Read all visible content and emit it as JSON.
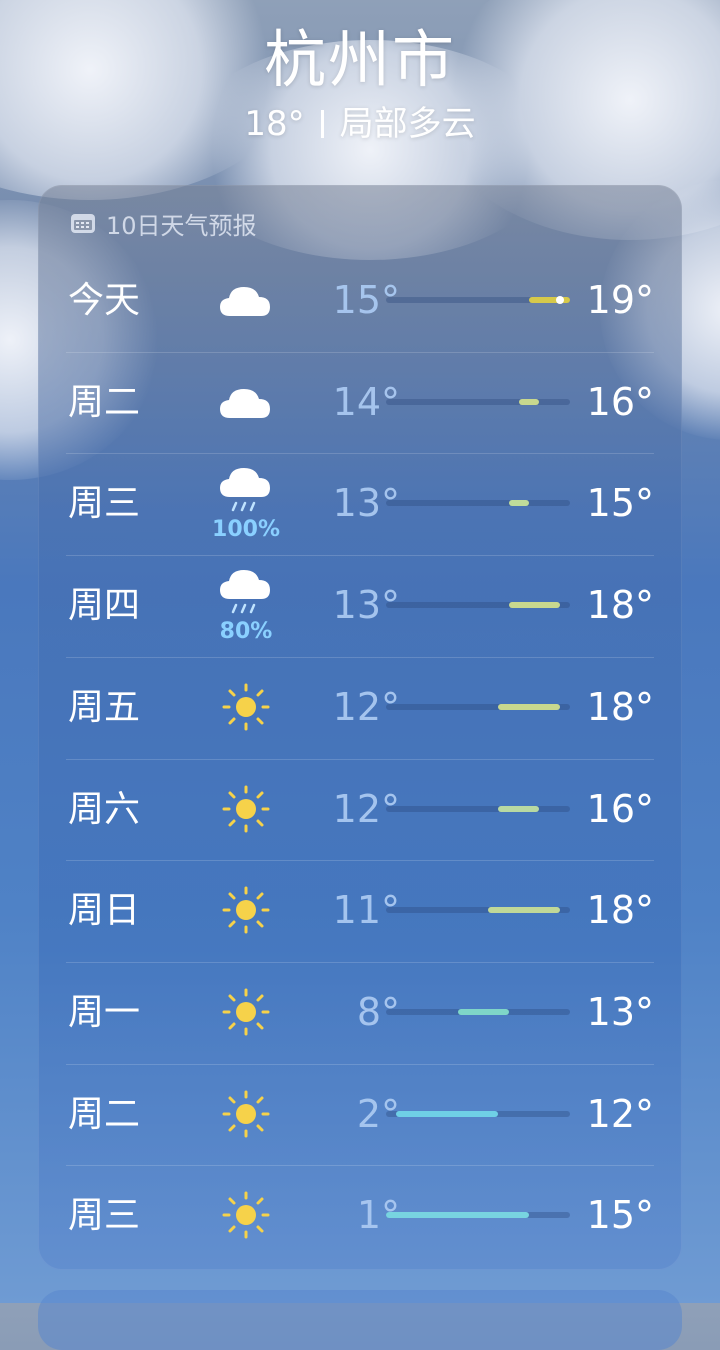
{
  "header": {
    "city": "杭州市",
    "current_temp": "18°",
    "condition": "局部多云"
  },
  "forecast": {
    "title": "10日天气预报",
    "icon": "calendar-icon",
    "range": {
      "min": 1,
      "max": 19
    },
    "current_temp_value": 18,
    "days": [
      {
        "day": "今天",
        "icon": "cloud",
        "low": "15°",
        "high": "19°",
        "low_v": 15,
        "high_v": 19,
        "color": "#d6c94a",
        "precip": ""
      },
      {
        "day": "周二",
        "icon": "cloud",
        "low": "14°",
        "high": "16°",
        "low_v": 14,
        "high_v": 16,
        "color": "#c8d88e",
        "precip": ""
      },
      {
        "day": "周三",
        "icon": "cloud-rain",
        "low": "13°",
        "high": "15°",
        "low_v": 13,
        "high_v": 15,
        "color": "#c0dc9a",
        "precip": "100%"
      },
      {
        "day": "周四",
        "icon": "cloud-rain",
        "low": "13°",
        "high": "18°",
        "low_v": 13,
        "high_v": 18,
        "color": "#c8d88e",
        "precip": "80%"
      },
      {
        "day": "周五",
        "icon": "sun",
        "low": "12°",
        "high": "18°",
        "low_v": 12,
        "high_v": 18,
        "color": "#c8d88e",
        "precip": ""
      },
      {
        "day": "周六",
        "icon": "sun",
        "low": "12°",
        "high": "16°",
        "low_v": 12,
        "high_v": 16,
        "color": "#b8d9a2",
        "precip": ""
      },
      {
        "day": "周日",
        "icon": "sun",
        "low": "11°",
        "high": "18°",
        "low_v": 11,
        "high_v": 18,
        "color": "#c0d898",
        "precip": ""
      },
      {
        "day": "周一",
        "icon": "sun",
        "low": "8°",
        "high": "13°",
        "low_v": 8,
        "high_v": 13,
        "color": "#7fd6c8",
        "precip": ""
      },
      {
        "day": "周二",
        "icon": "sun",
        "low": "2°",
        "high": "12°",
        "low_v": 2,
        "high_v": 12,
        "color": "#6fd0e6",
        "precip": ""
      },
      {
        "day": "周三",
        "icon": "sun",
        "low": "1°",
        "high": "15°",
        "low_v": 1,
        "high_v": 15,
        "color": "#78d4e0",
        "precip": ""
      }
    ]
  }
}
